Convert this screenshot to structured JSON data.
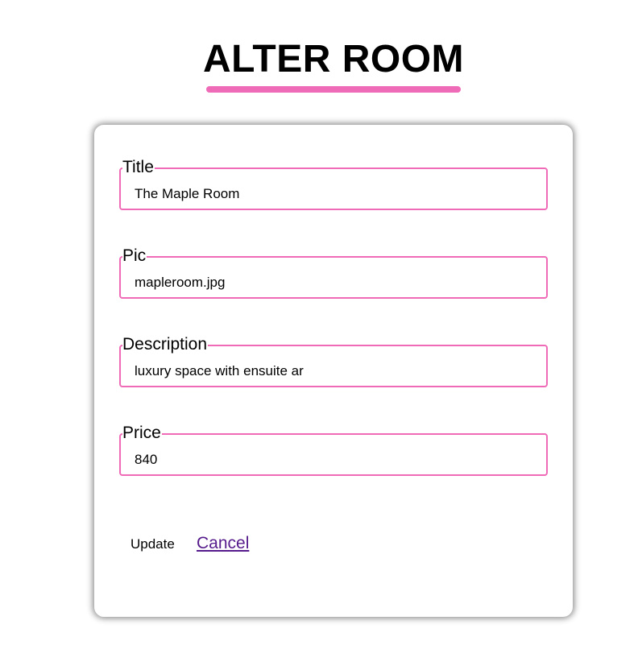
{
  "page": {
    "title": "ALTER ROOM",
    "accent_color": "#f06bb7"
  },
  "form": {
    "fields": [
      {
        "label": "Title",
        "value": "The Maple Room"
      },
      {
        "label": "Pic",
        "value": "mapleroom.jpg"
      },
      {
        "label": "Description",
        "value": "luxury space with ensuite ar"
      },
      {
        "label": "Price",
        "value": "840"
      }
    ],
    "update_label": "Update",
    "cancel_label": "Cancel"
  }
}
